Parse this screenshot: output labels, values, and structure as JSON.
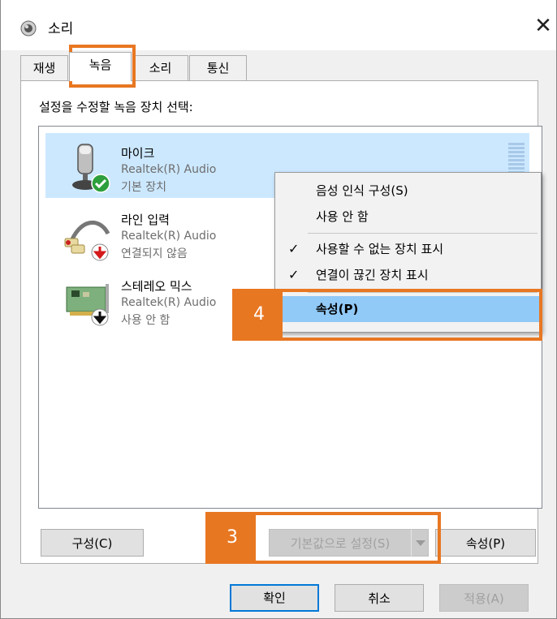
{
  "window": {
    "title": "소리",
    "close_glyph": "✕"
  },
  "tabs": [
    {
      "label": "재생"
    },
    {
      "label": "녹음"
    },
    {
      "label": "소리"
    },
    {
      "label": "통신"
    }
  ],
  "panel_label": "설정을 수정할 녹음 장치 선택:",
  "devices": [
    {
      "name": "마이크",
      "driver": "Realtek(R) Audio",
      "status": "기본 장치",
      "icon": "microphone-icon",
      "badge": "green-check-badge"
    },
    {
      "name": "라인 입력",
      "driver": "Realtek(R) Audio",
      "status": "연결되지 않음",
      "icon": "line-in-cable-icon",
      "badge": "red-down-arrow-badge"
    },
    {
      "name": "스테레오 믹스",
      "driver": "Realtek(R) Audio",
      "status": "사용 안 함",
      "icon": "sound-card-icon",
      "badge": "black-down-arrow-badge"
    }
  ],
  "context_menu": {
    "items": [
      {
        "label": "음성 인식 구성(S)"
      },
      {
        "label": "사용 안 함"
      },
      {
        "label": "사용할 수 없는 장치 표시",
        "checked": true
      },
      {
        "label": "연결이 끊긴 장치 표시",
        "checked": true
      },
      {
        "label": "속성(P)",
        "highlighted": true
      }
    ],
    "check_glyph": "✓"
  },
  "buttons": {
    "configure": "구성(C)",
    "set_default": "기본값으로 설정(S)",
    "properties": "속성(P)",
    "ok": "확인",
    "cancel": "취소",
    "apply": "적용(A)"
  },
  "annotations": {
    "step3": "3",
    "step4": "4",
    "color": "#e87722"
  }
}
